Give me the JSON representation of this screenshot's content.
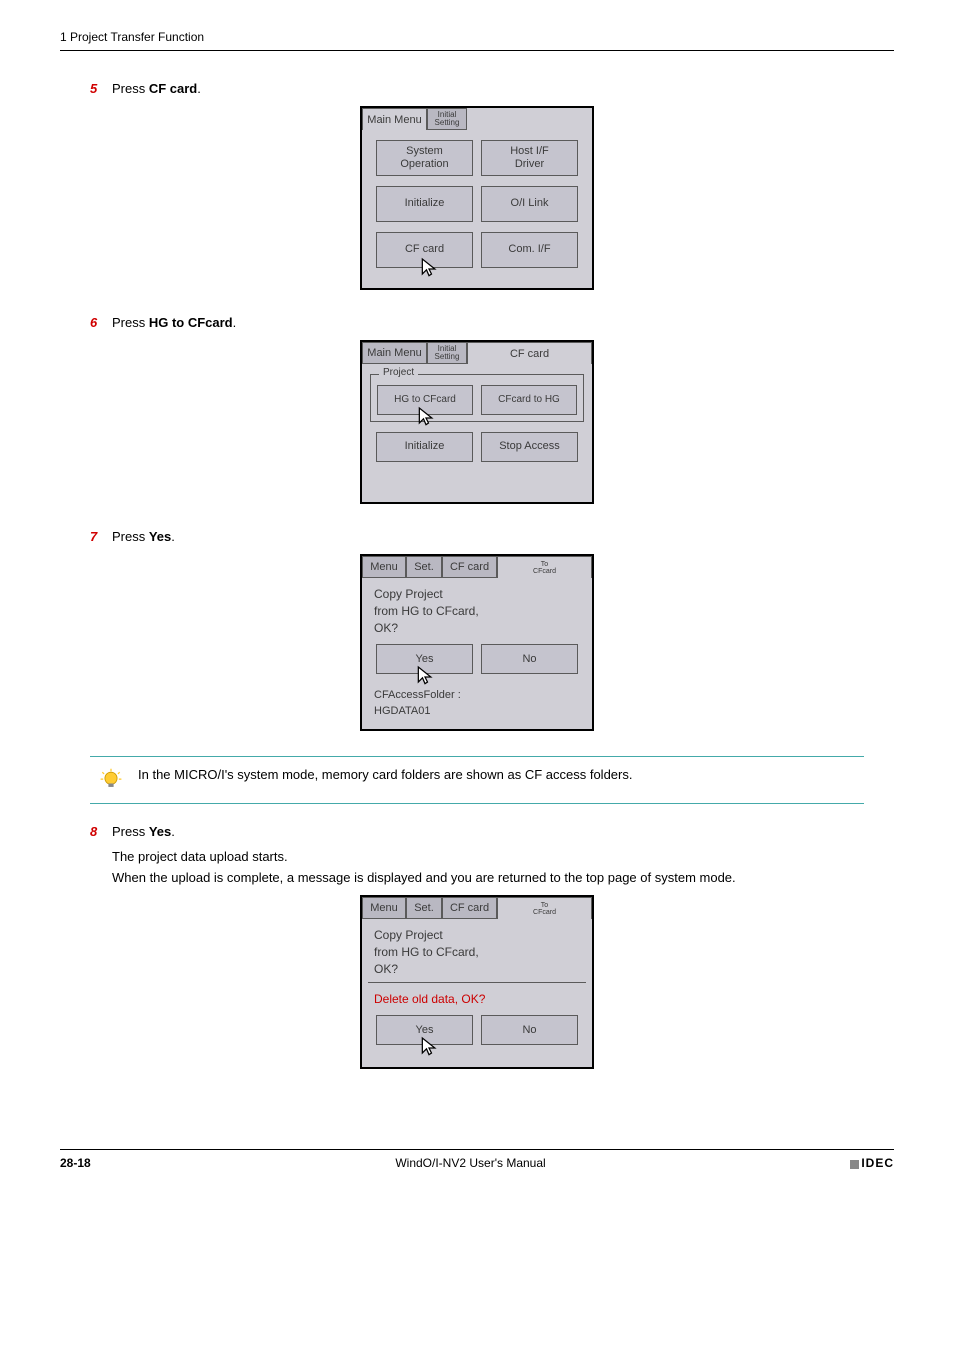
{
  "header": {
    "section": "1 Project Transfer Function"
  },
  "steps": {
    "s5": {
      "num": "5",
      "pre": "Press ",
      "bold": "CF card",
      "post": "."
    },
    "s6": {
      "num": "6",
      "pre": "Press ",
      "bold": "HG to CFcard",
      "post": "."
    },
    "s7": {
      "num": "7",
      "pre": "Press ",
      "bold": "Yes",
      "post": "."
    },
    "s8": {
      "num": "8",
      "pre": "Press ",
      "bold": "Yes",
      "post": "."
    }
  },
  "s8_sub1": "The project data upload starts.",
  "s8_sub2": "When the upload is complete, a message is displayed and you are returned to the top page of system mode.",
  "tip": "In the MICRO/I's system mode, memory card folders are shown as CF access folders.",
  "screen1": {
    "tab1": "Main Menu",
    "tab2_l1": "Initial",
    "tab2_l2": "Setting",
    "btn1": "System\nOperation",
    "btn2": "Host I/F\nDriver",
    "btn3": "Initialize",
    "btn4": "O/I Link",
    "btn5": "CF card",
    "btn6": "Com. I/F"
  },
  "screen2": {
    "tab1": "Main Menu",
    "tab2_l1": "Initial",
    "tab2_l2": "Setting",
    "tab3": "CF card",
    "group": "Project",
    "btn1": "HG to CFcard",
    "btn2": "CFcard to HG",
    "btn3": "Initialize",
    "btn4": "Stop Access"
  },
  "screen3": {
    "tab1": "Menu",
    "tab2": "Set.",
    "tab3": "CF card",
    "tab4_l1": "To",
    "tab4_l2": "CFcard",
    "msg": "Copy Project\nfrom HG to CFcard,\nOK?",
    "yes": "Yes",
    "no": "No",
    "folder": "CFAccessFolder :\nHGDATA01"
  },
  "screen4": {
    "tab1": "Menu",
    "tab2": "Set.",
    "tab3": "CF card",
    "tab4_l1": "To",
    "tab4_l2": "CFcard",
    "msg": "Copy Project\nfrom HG to CFcard,\nOK?",
    "warn": "Delete old data, OK?",
    "yes": "Yes",
    "no": "No"
  },
  "footer": {
    "page": "28-18",
    "title": "WindO/I-NV2 User's Manual",
    "brand": "IDEC"
  }
}
